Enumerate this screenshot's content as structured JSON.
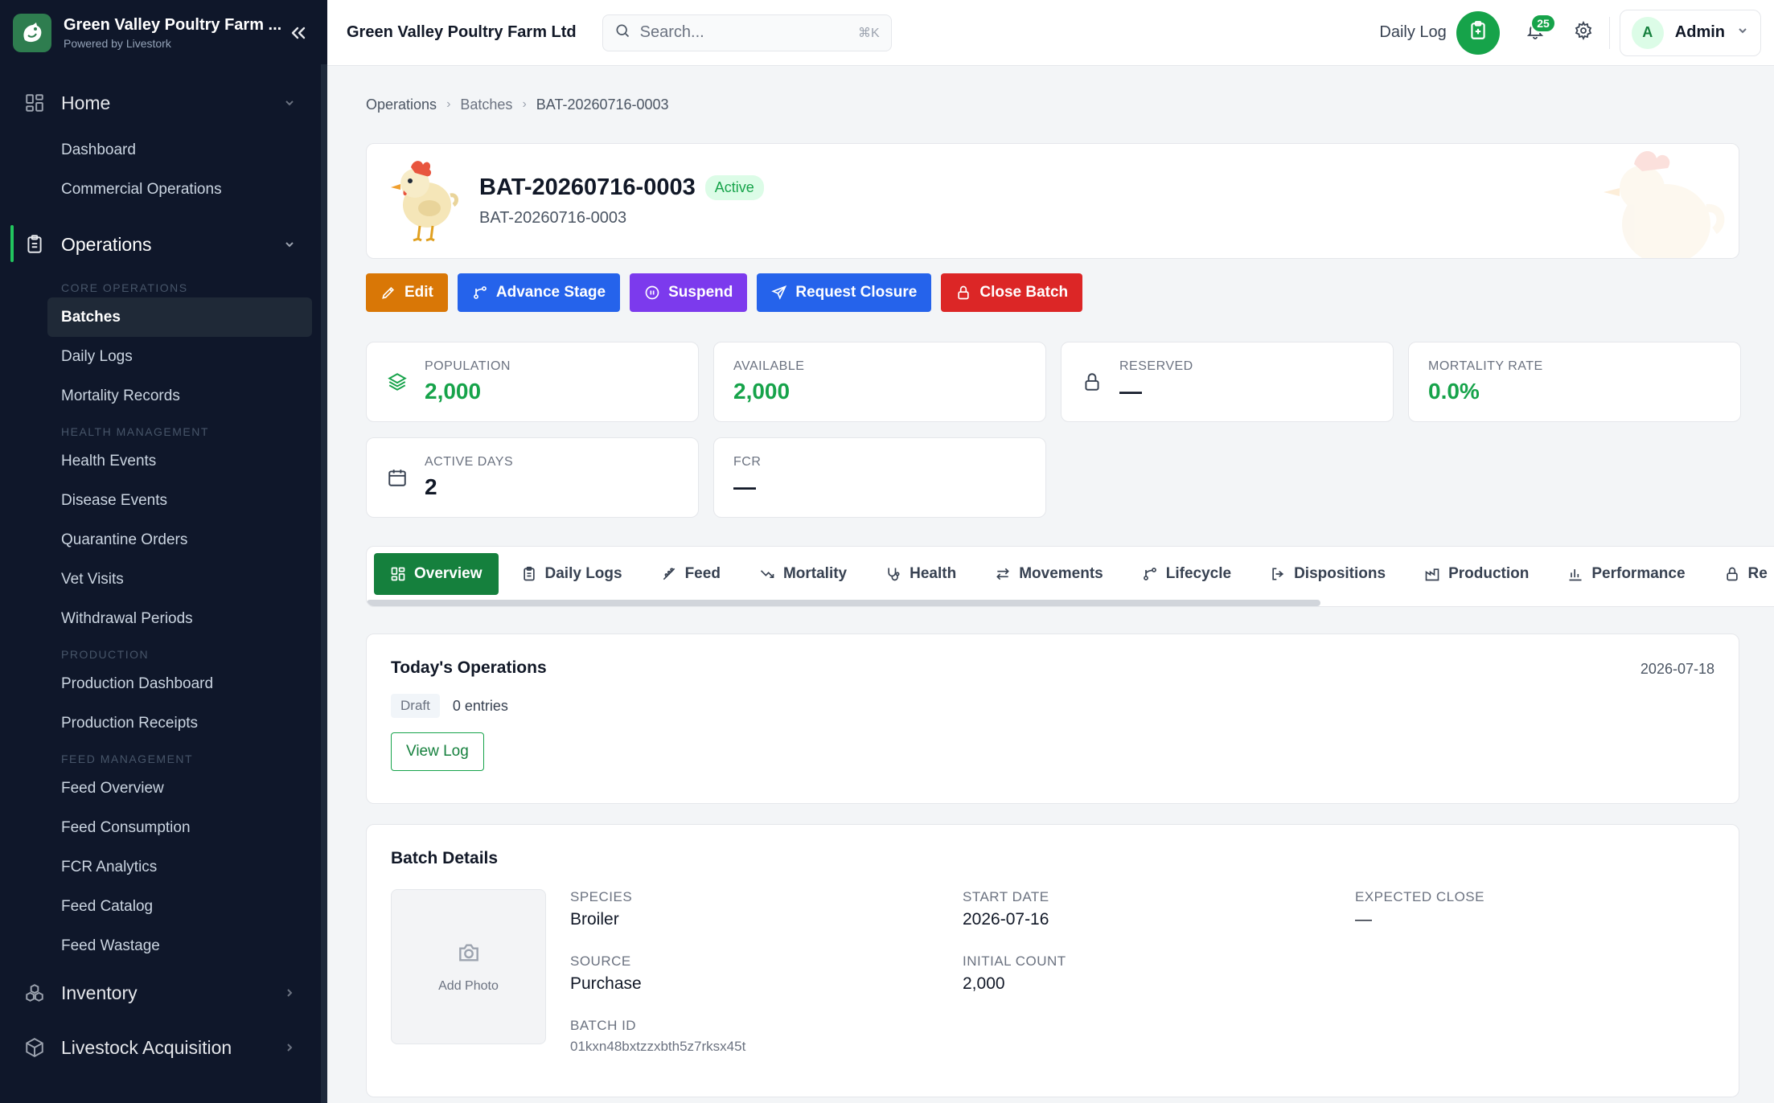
{
  "brand": {
    "title": "Green Valley Poultry Farm ...",
    "subtitle": "Powered by Livestork"
  },
  "sidebar": {
    "home": {
      "label": "Home",
      "items": [
        "Dashboard",
        "Commercial Operations"
      ]
    },
    "operations": {
      "label": "Operations",
      "sections": [
        {
          "title": "CORE OPERATIONS",
          "items": [
            "Batches",
            "Daily Logs",
            "Mortality Records"
          ]
        },
        {
          "title": "HEALTH MANAGEMENT",
          "items": [
            "Health Events",
            "Disease Events",
            "Quarantine Orders",
            "Vet Visits",
            "Withdrawal Periods"
          ]
        },
        {
          "title": "PRODUCTION",
          "items": [
            "Production Dashboard",
            "Production Receipts"
          ]
        },
        {
          "title": "FEED MANAGEMENT",
          "items": [
            "Feed Overview",
            "Feed Consumption",
            "FCR Analytics",
            "Feed Catalog",
            "Feed Wastage"
          ]
        }
      ]
    },
    "inventory": {
      "label": "Inventory"
    },
    "livestock": {
      "label": "Livestock Acquisition"
    },
    "selected_item": "Batches"
  },
  "topbar": {
    "org_name": "Green Valley Poultry Farm Ltd",
    "search_placeholder": "Search...",
    "search_shortcut": "⌘K",
    "daily_log_label": "Daily Log",
    "notification_count": "25",
    "user_initial": "A",
    "user_name": "Admin"
  },
  "breadcrumb": [
    "Operations",
    "Batches",
    "BAT-20260716-0003"
  ],
  "batch": {
    "title": "BAT-20260716-0003",
    "subtitle": "BAT-20260716-0003",
    "status": "Active"
  },
  "actions": {
    "edit": "Edit",
    "advance": "Advance Stage",
    "suspend": "Suspend",
    "request_closure": "Request Closure",
    "close_batch": "Close Batch"
  },
  "stats": {
    "population": {
      "label": "POPULATION",
      "value": "2,000"
    },
    "available": {
      "label": "AVAILABLE",
      "value": "2,000"
    },
    "reserved": {
      "label": "RESERVED",
      "value": "—"
    },
    "mortality": {
      "label": "MORTALITY RATE",
      "value": "0.0%"
    },
    "active_days": {
      "label": "ACTIVE DAYS",
      "value": "2"
    },
    "fcr": {
      "label": "FCR",
      "value": "—"
    }
  },
  "tabs": [
    "Overview",
    "Daily Logs",
    "Feed",
    "Mortality",
    "Health",
    "Movements",
    "Lifecycle",
    "Dispositions",
    "Production",
    "Performance",
    "Re"
  ],
  "today_ops": {
    "title": "Today's Operations",
    "date": "2026-07-18",
    "status": "Draft",
    "entries": "0 entries",
    "view_log": "View Log"
  },
  "batch_details": {
    "title": "Batch Details",
    "add_photo": "Add Photo",
    "species_label": "SPECIES",
    "species": "Broiler",
    "start_date_label": "START DATE",
    "start_date": "2026-07-16",
    "expected_close_label": "EXPECTED CLOSE",
    "expected_close": "—",
    "source_label": "SOURCE",
    "source": "Purchase",
    "initial_count_label": "INITIAL COUNT",
    "initial_count": "2,000",
    "batch_id_label": "BATCH ID",
    "batch_id": "01kxn48bxtzzxbth5z7rksx45t"
  },
  "colors": {
    "sidebar_bg": "#0f172a",
    "accent_green": "#16a34a",
    "edit": "#d97706",
    "advance": "#2563eb",
    "suspend": "#7c3aed",
    "close": "#dc2626"
  }
}
